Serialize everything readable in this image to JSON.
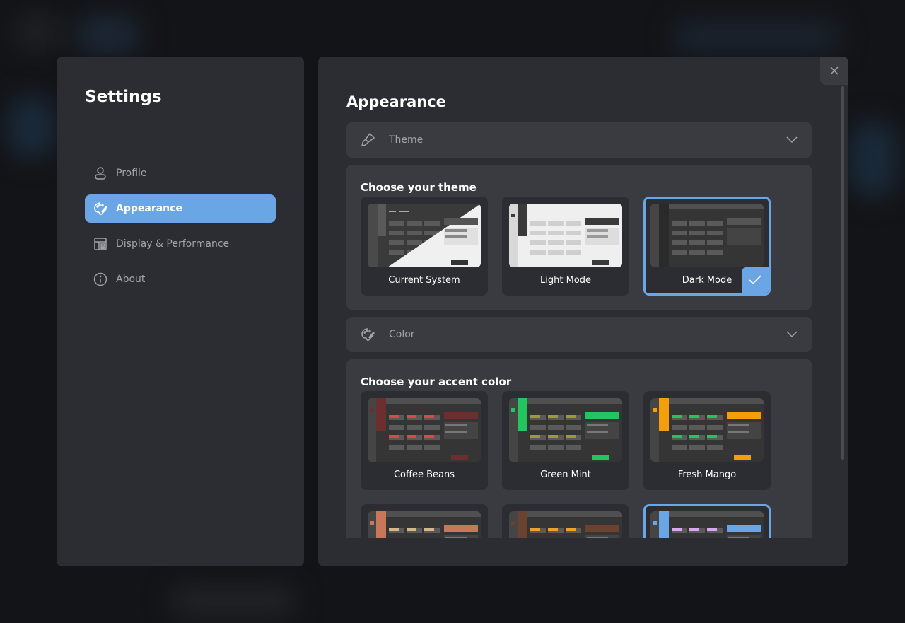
{
  "window": {
    "title": "Settings"
  },
  "sidebar": {
    "items": [
      {
        "label": "Profile",
        "icon": "user-icon",
        "active": false
      },
      {
        "label": "Appearance",
        "icon": "palette-icon",
        "active": true
      },
      {
        "label": "Display & Performance",
        "icon": "layout-icon",
        "active": false
      },
      {
        "label": "About",
        "icon": "info-icon",
        "active": false
      }
    ]
  },
  "main": {
    "title": "Appearance",
    "theme_accordion": {
      "label": "Theme",
      "icon": "brush-icon"
    },
    "theme_section": {
      "title": "Choose your theme",
      "options": [
        {
          "label": "Current System",
          "selected": false
        },
        {
          "label": "Light Mode",
          "selected": false
        },
        {
          "label": "Dark Mode",
          "selected": true
        }
      ]
    },
    "color_accordion": {
      "label": "Color",
      "icon": "palette-icon"
    },
    "color_section": {
      "title": "Choose your accent color",
      "options": [
        {
          "label": "Coffee Beans",
          "accent": "#6b2f2f",
          "secondary": "#d9474f"
        },
        {
          "label": "Green Mint",
          "accent": "#22c55e",
          "secondary": "#9a9a3a"
        },
        {
          "label": "Fresh Mango",
          "accent": "#f59e0b",
          "secondary": "#22c55e"
        },
        {
          "label": "",
          "accent": "#c8785a",
          "secondary": "#d4b88a"
        },
        {
          "label": "",
          "accent": "#6b4230",
          "secondary": "#f0a030"
        },
        {
          "label": "",
          "accent": "#6aa5e6",
          "secondary": "#d8a8f0",
          "selected": true
        }
      ]
    }
  },
  "colors": {
    "panel": "#2c2d32",
    "card": "#3a3b40",
    "accent": "#6aa5e6"
  }
}
